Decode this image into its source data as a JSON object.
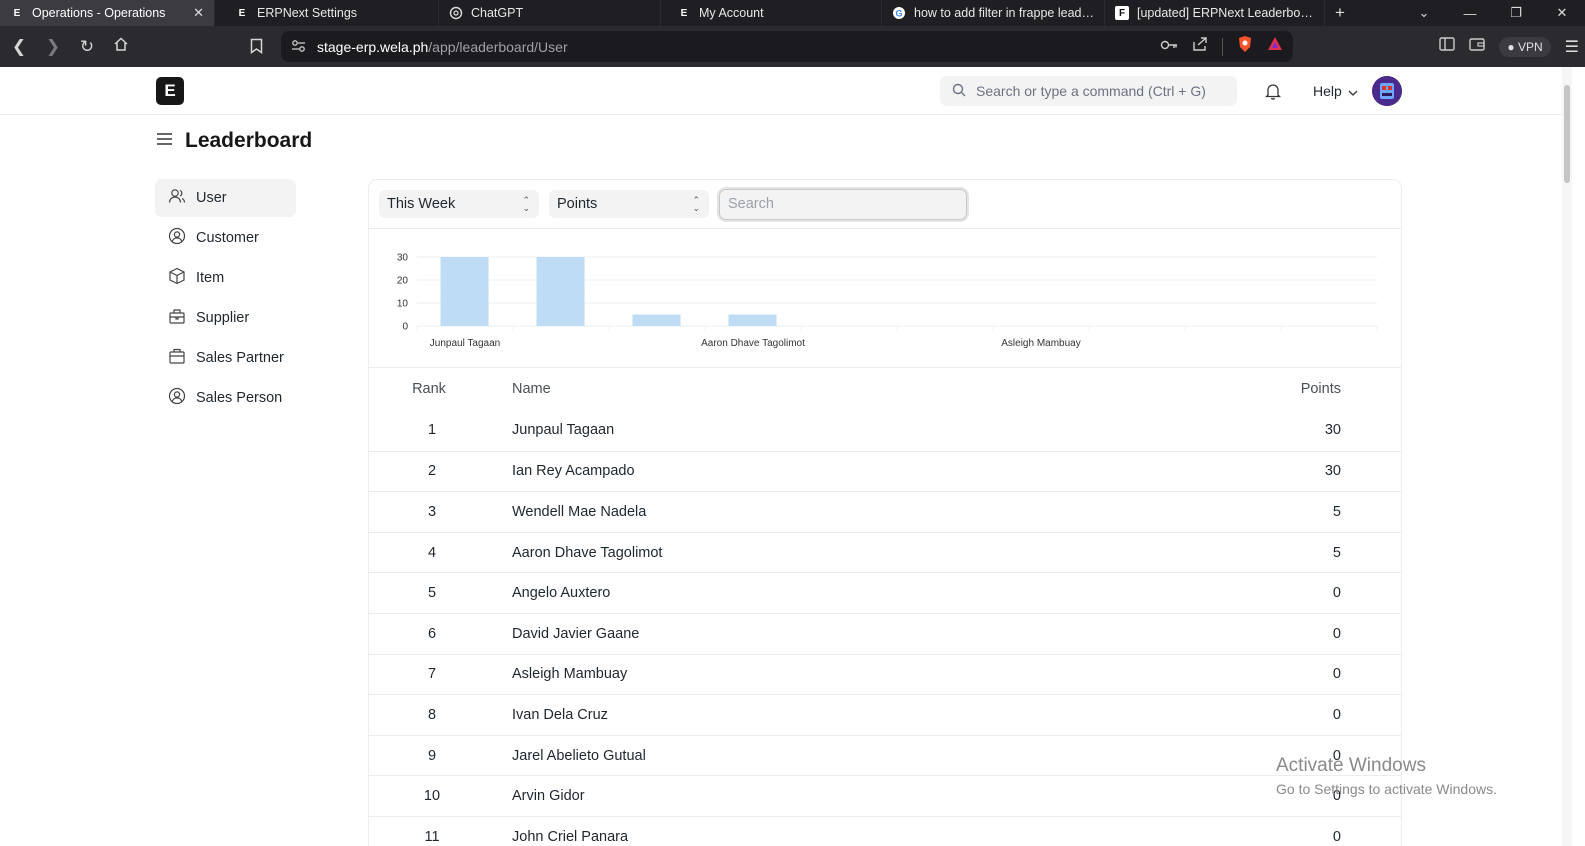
{
  "browser": {
    "tabs": [
      {
        "title": "Operations - Operations",
        "favicon": "erpnext-favicon",
        "active": true
      },
      {
        "title": "ERPNext Settings",
        "favicon": "erpnext-favicon"
      },
      {
        "title": "ChatGPT",
        "favicon": "chatgpt-favicon"
      },
      {
        "title": "My Account",
        "favicon": "erpnext-favicon"
      },
      {
        "title": "how to add filter in frappe leaderl",
        "favicon": "google-favicon"
      },
      {
        "title": "[updated] ERPNext Leaderboard -",
        "favicon": "frappe-favicon"
      }
    ],
    "url_host": "stage-erp.wela.ph",
    "url_path": "/app/leaderboard/User",
    "vpn_label": "VPN"
  },
  "header": {
    "logo_letter": "E",
    "search_placeholder": "Search or type a command (Ctrl + G)",
    "help_label": "Help"
  },
  "page": {
    "title": "Leaderboard"
  },
  "sidebar": {
    "items": [
      {
        "label": "User",
        "icon": "user-icon",
        "active": true
      },
      {
        "label": "Customer",
        "icon": "customer-icon"
      },
      {
        "label": "Item",
        "icon": "item-box-icon"
      },
      {
        "label": "Supplier",
        "icon": "supplier-icon"
      },
      {
        "label": "Sales Partner",
        "icon": "sales-partner-icon"
      },
      {
        "label": "Sales Person",
        "icon": "sales-person-icon"
      }
    ]
  },
  "filters": {
    "period": "This Week",
    "field": "Points",
    "search_placeholder": "Search"
  },
  "chart_data": {
    "type": "bar",
    "categories": [
      "Junpaul Tagaan",
      "Ian Rey Acampado",
      "Wendell Mae Nadela",
      "Aaron Dhave Tagolimot",
      "Angelo Auxtero",
      "David Javier Gaane",
      "Asleigh Mambuay",
      "Ivan Dela Cruz",
      "Jarel Abelieto Gutual",
      "Arvin Gidor"
    ],
    "visible_x_labels": [
      "Junpaul Tagaan",
      "Aaron Dhave Tagolimot",
      "Asleigh Mambuay"
    ],
    "values": [
      30,
      30,
      5,
      5,
      0,
      0,
      0,
      0,
      0,
      0
    ],
    "y_ticks": [
      0,
      10,
      20,
      30
    ],
    "ylim": [
      0,
      30
    ],
    "bar_color": "#bfdcf5"
  },
  "table": {
    "headers": {
      "rank": "Rank",
      "name": "Name",
      "points": "Points"
    },
    "rows": [
      {
        "rank": "1",
        "name": "Junpaul Tagaan",
        "points": "30"
      },
      {
        "rank": "2",
        "name": "Ian Rey Acampado",
        "points": "30"
      },
      {
        "rank": "3",
        "name": "Wendell Mae Nadela",
        "points": "5"
      },
      {
        "rank": "4",
        "name": "Aaron Dhave Tagolimot",
        "points": "5"
      },
      {
        "rank": "5",
        "name": "Angelo Auxtero",
        "points": "0"
      },
      {
        "rank": "6",
        "name": "David Javier Gaane",
        "points": "0"
      },
      {
        "rank": "7",
        "name": "Asleigh Mambuay",
        "points": "0"
      },
      {
        "rank": "8",
        "name": "Ivan Dela Cruz",
        "points": "0"
      },
      {
        "rank": "9",
        "name": "Jarel Abelieto Gutual",
        "points": "0"
      },
      {
        "rank": "10",
        "name": "Arvin Gidor",
        "points": "0"
      },
      {
        "rank": "11",
        "name": "John Criel Panara",
        "points": "0"
      }
    ]
  },
  "watermark": {
    "line1": "Activate Windows",
    "line2": "Go to Settings to activate Windows."
  }
}
